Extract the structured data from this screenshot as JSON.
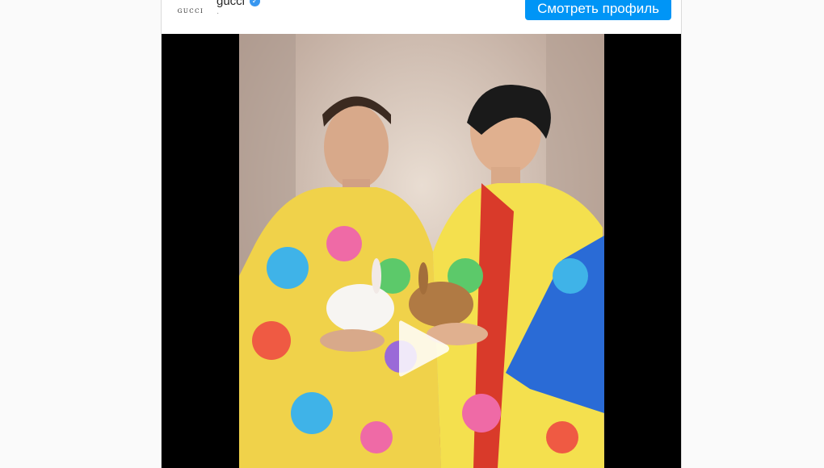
{
  "post": {
    "avatar_text": "GUCCI",
    "username": "gucci",
    "verified_glyph": "✓",
    "subline": "·",
    "view_profile_label": "Смотреть профиль"
  },
  "media": {
    "type": "video",
    "description_icon": "play-icon"
  },
  "colors": {
    "accent": "#0095f6",
    "verified": "#3897f0",
    "media_bg": "#000000"
  }
}
